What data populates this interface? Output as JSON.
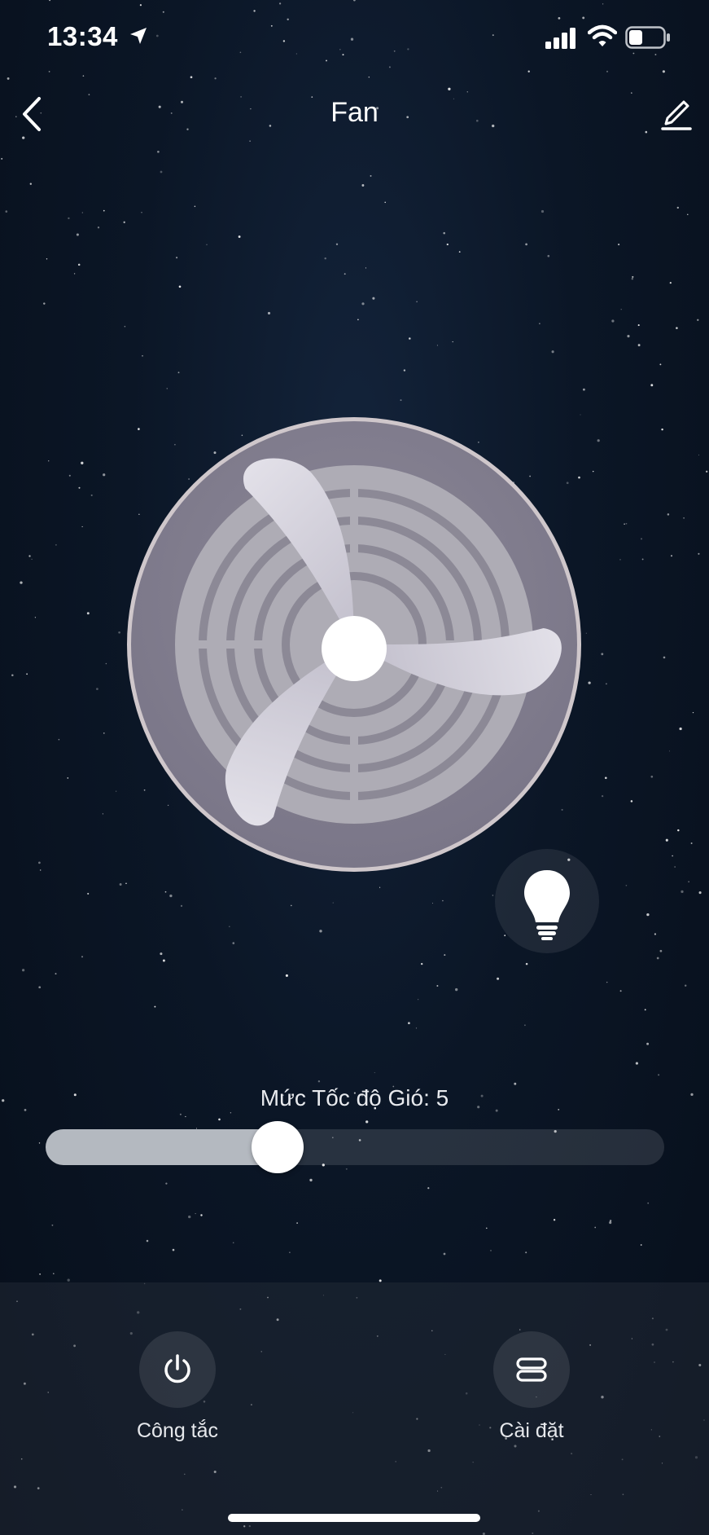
{
  "status_bar": {
    "time": "13:34"
  },
  "nav": {
    "title": "Fan"
  },
  "device": {
    "light_state": "on"
  },
  "speed": {
    "label": "Mức Tốc độ Gió: 5",
    "value": 5,
    "fraction": 0.375
  },
  "actions": [
    {
      "label": "Công tắc",
      "icon": "power-icon"
    },
    {
      "label": "Cài đặt",
      "icon": "settings-icon"
    }
  ],
  "colors": {
    "slider_fill": "#b4b9c0",
    "fan_body": "#8f8a99",
    "background": "#0b1626"
  }
}
